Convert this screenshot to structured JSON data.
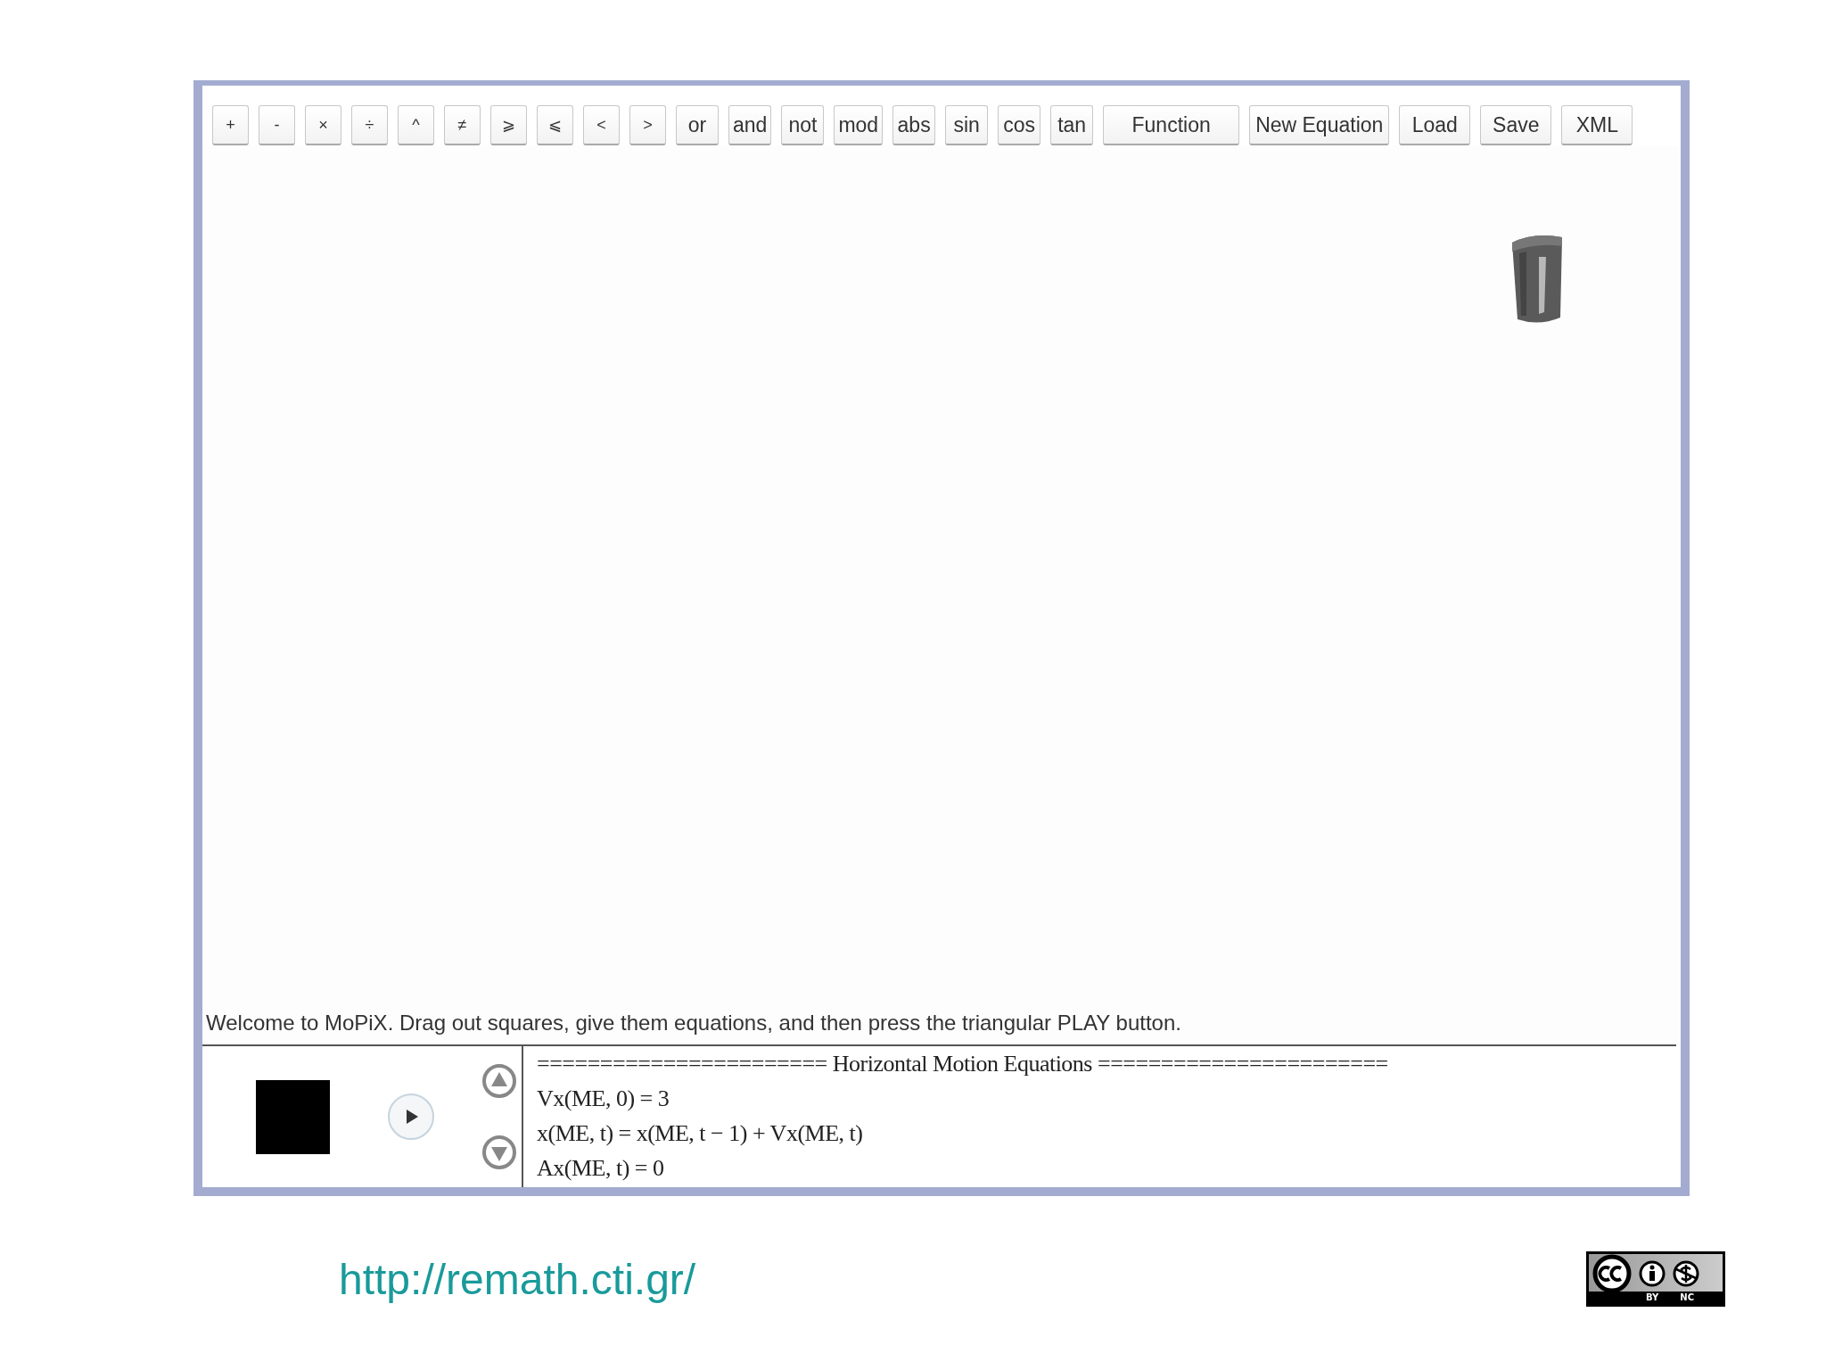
{
  "toolbar": {
    "buttons": [
      {
        "label": "+",
        "kind": "op"
      },
      {
        "label": "-",
        "kind": "op"
      },
      {
        "label": "×",
        "kind": "op"
      },
      {
        "label": "÷",
        "kind": "op"
      },
      {
        "label": "^",
        "kind": "op"
      },
      {
        "label": "≠",
        "kind": "op"
      },
      {
        "label": "⩾",
        "kind": "op"
      },
      {
        "label": "⩽",
        "kind": "op"
      },
      {
        "label": "<",
        "kind": "op"
      },
      {
        "label": ">",
        "kind": "op"
      },
      {
        "label": "or",
        "kind": "word"
      },
      {
        "label": "and",
        "kind": "word"
      },
      {
        "label": "not",
        "kind": "word"
      },
      {
        "label": "mod",
        "kind": "word"
      },
      {
        "label": "abs",
        "kind": "word"
      },
      {
        "label": "sin",
        "kind": "word"
      },
      {
        "label": "cos",
        "kind": "word"
      },
      {
        "label": "tan",
        "kind": "word"
      },
      {
        "label": "Function",
        "kind": "action"
      },
      {
        "label": "New Equation",
        "kind": "action"
      },
      {
        "label": "Load",
        "kind": "action"
      },
      {
        "label": "Save",
        "kind": "action"
      },
      {
        "label": "XML",
        "kind": "action"
      }
    ]
  },
  "status_message": "Welcome to MoPiX. Drag out squares, give them equations, and then press the triangular PLAY button.",
  "equations": [
    "======================= Horizontal Motion Equations =======================",
    "Vx(ME, 0) = 3",
    "x(ME, t) = x(ME, t − 1) + Vx(ME, t)",
    "Ax(ME, t) = 0"
  ],
  "footer": {
    "url": "http://remath.cti.gr/",
    "license_labels": [
      "BY",
      "NC"
    ]
  }
}
